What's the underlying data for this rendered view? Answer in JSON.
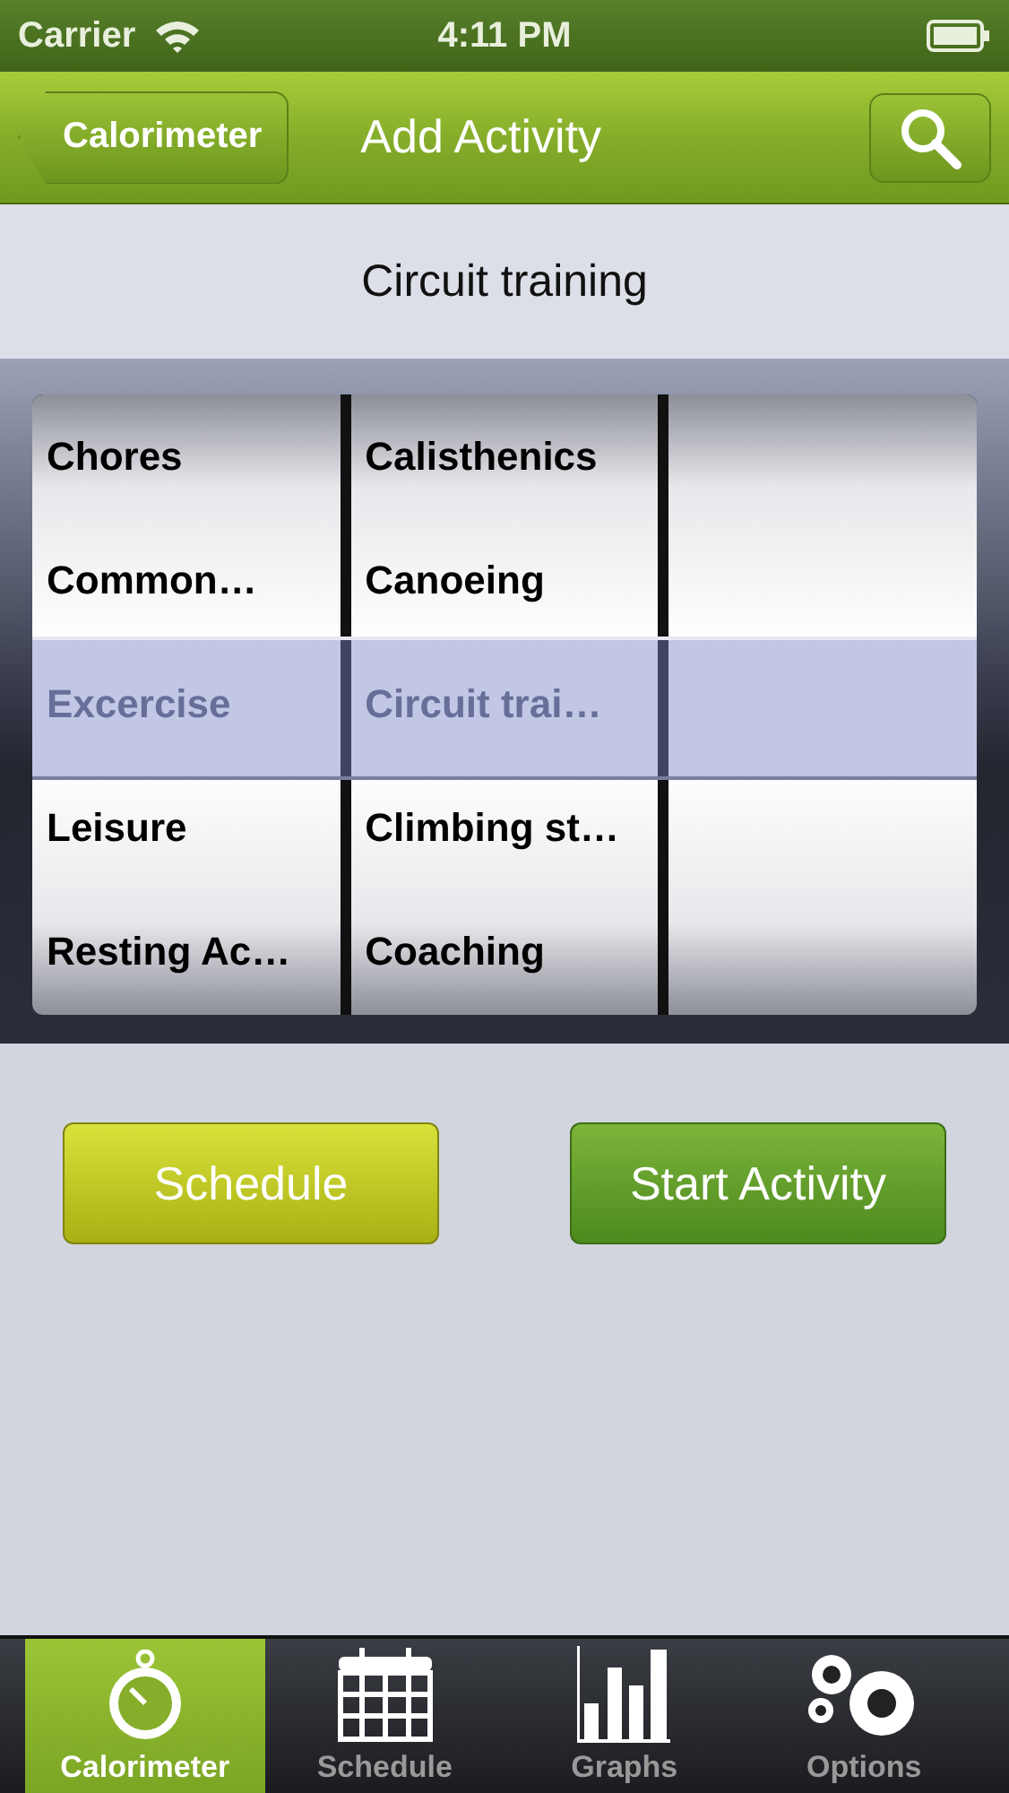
{
  "status_bar": {
    "carrier": "Carrier",
    "time": "4:11 PM"
  },
  "nav_bar": {
    "back": "Calorimeter",
    "title": "Add Activity"
  },
  "selection": "Circuit training",
  "picker": {
    "columns": [
      {
        "items": [
          {
            "label": "Chores",
            "selected": false
          },
          {
            "label": "Common…",
            "selected": false
          },
          {
            "label": "Excercise",
            "selected": true
          },
          {
            "label": "Leisure",
            "selected": false
          },
          {
            "label": "Resting Ac…",
            "selected": false
          }
        ]
      },
      {
        "items": [
          {
            "label": "Calisthenics",
            "selected": false
          },
          {
            "label": "Canoeing",
            "selected": false
          },
          {
            "label": "Circuit trai…",
            "selected": true
          },
          {
            "label": "Climbing st…",
            "selected": false
          },
          {
            "label": "Coaching",
            "selected": false
          }
        ]
      }
    ]
  },
  "buttons": [
    {
      "label": "Schedule",
      "kind": "secondary"
    },
    {
      "label": "Start Activity",
      "kind": "primary"
    }
  ],
  "tabs": [
    {
      "label": "Calorimeter",
      "selected": true
    },
    {
      "label": "Schedule",
      "selected": false
    },
    {
      "label": "Graphs",
      "selected": false
    },
    {
      "label": "Options",
      "selected": false
    }
  ]
}
